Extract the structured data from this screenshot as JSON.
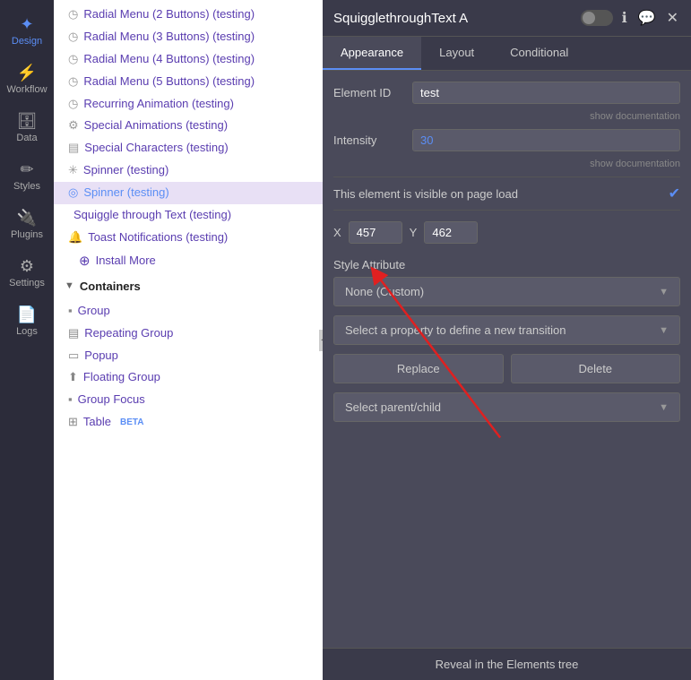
{
  "nav": {
    "items": [
      {
        "id": "design",
        "label": "Design",
        "icon": "✦",
        "active": true
      },
      {
        "id": "workflow",
        "label": "Workflow",
        "icon": "⚡",
        "active": false
      },
      {
        "id": "data",
        "label": "Data",
        "icon": "🗄",
        "active": false
      },
      {
        "id": "styles",
        "label": "Styles",
        "icon": "✏",
        "active": false
      },
      {
        "id": "plugins",
        "label": "Plugins",
        "icon": "🔌",
        "active": false
      },
      {
        "id": "settings",
        "label": "Settings",
        "icon": "⚙",
        "active": false
      },
      {
        "id": "logs",
        "label": "Logs",
        "icon": "📄",
        "active": false
      }
    ]
  },
  "elements": {
    "items": [
      {
        "id": "radial2",
        "text": "Radial Menu (2 Buttons) (testing)",
        "icon": "◷"
      },
      {
        "id": "radial3",
        "text": "Radial Menu (3 Buttons) (testing)",
        "icon": "◷"
      },
      {
        "id": "radial4",
        "text": "Radial Menu (4 Buttons) (testing)",
        "icon": "◷"
      },
      {
        "id": "radial5",
        "text": "Radial Menu (5 Buttons) (testing)",
        "icon": "◷"
      },
      {
        "id": "recurring",
        "text": "Recurring Animation (testing)",
        "icon": "◷"
      },
      {
        "id": "special-anim",
        "text": "Special Animations (testing)",
        "icon": "⚙"
      },
      {
        "id": "special-chars",
        "text": "Special Characters (testing)",
        "icon": "▤"
      },
      {
        "id": "spinner",
        "text": "Spinner (testing)",
        "icon": "✳"
      },
      {
        "id": "spinner-active",
        "text": "Spinner (testing)",
        "icon": "◎",
        "active": true
      },
      {
        "id": "squiggle",
        "text": "Squiggle through Text (testing)",
        "icon": ""
      },
      {
        "id": "toast",
        "text": "Toast Notifications (testing)",
        "icon": "🔔"
      }
    ],
    "install_more": "Install More",
    "containers_label": "Containers",
    "containers": [
      {
        "id": "group",
        "text": "Group",
        "icon": "▪"
      },
      {
        "id": "repeating-group",
        "text": "Repeating Group",
        "icon": "▤"
      },
      {
        "id": "popup",
        "text": "Popup",
        "icon": "▭"
      },
      {
        "id": "floating-group",
        "text": "Floating Group",
        "icon": "⬆"
      },
      {
        "id": "group-focus",
        "text": "Group Focus",
        "icon": "▪"
      },
      {
        "id": "table",
        "text": "Table",
        "icon": "⊞",
        "badge": "BETA"
      }
    ]
  },
  "panel": {
    "title": "SquigglethroughText A",
    "tabs": [
      "Appearance",
      "Layout",
      "Conditional"
    ],
    "active_tab": "Appearance",
    "element_id_label": "Element ID",
    "element_id_value": "test",
    "intensity_label": "Intensity",
    "intensity_value": "30",
    "show_doc": "show documentation",
    "visibility_text": "This element is visible on page load",
    "x_label": "X",
    "x_value": "457",
    "y_label": "Y",
    "y_value": "462",
    "style_attr_label": "Style Attribute",
    "style_attr_value": "None (Custom)",
    "transition_placeholder": "Select a property to define a new transition",
    "replace_label": "Replace",
    "delete_label": "Delete",
    "parent_child_placeholder": "Select parent/child",
    "reveal_label": "Reveal in the Elements tree"
  }
}
